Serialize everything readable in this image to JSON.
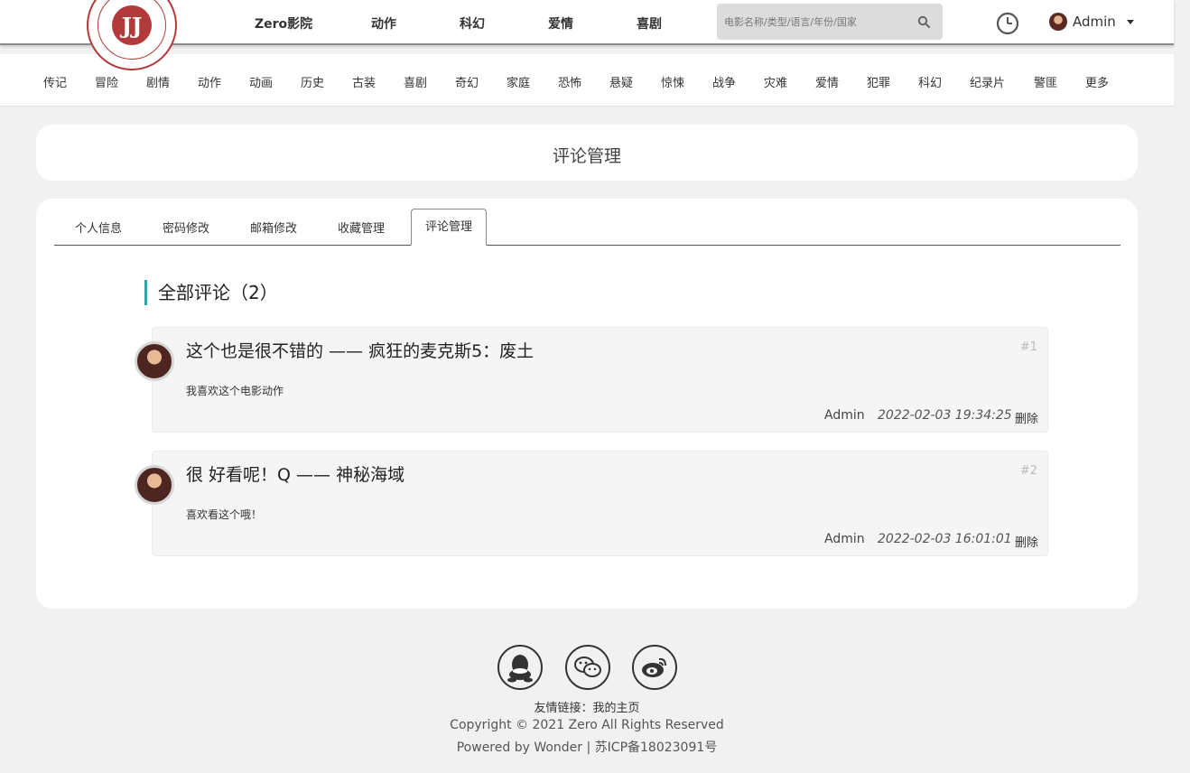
{
  "header": {
    "logo_text": "JJ",
    "nav": [
      "Zero影院",
      "动作",
      "科幻",
      "爱情",
      "喜剧"
    ],
    "search_placeholder": "电影名称/类型/语言/年份/国家",
    "user_name": "Admin"
  },
  "genres": [
    "传记",
    "冒险",
    "剧情",
    "动作",
    "动画",
    "历史",
    "古装",
    "喜剧",
    "奇幻",
    "家庭",
    "恐怖",
    "悬疑",
    "惊悚",
    "战争",
    "灾难",
    "爱情",
    "犯罪",
    "科幻",
    "纪录片",
    "警匪",
    "更多"
  ],
  "page_title": "评论管理",
  "tabs": [
    "个人信息",
    "密码修改",
    "邮箱修改",
    "收藏管理",
    "评论管理"
  ],
  "active_tab": "评论管理",
  "section_title": "全部评论（2）",
  "comments": [
    {
      "title": "这个也是很不错的 —— 疯狂的麦克斯5：废土",
      "num": "#1",
      "text": "我喜欢这个电影动作",
      "author": "Admin",
      "time": "2022-02-03 19:34:25",
      "delete_label": "删除"
    },
    {
      "title": "很 好看呢！Q —— 神秘海域",
      "num": "#2",
      "text": "喜欢看这个哦！",
      "author": "Admin",
      "time": "2022-02-03 16:01:01",
      "delete_label": "删除"
    }
  ],
  "footer": {
    "social_icons": [
      "qq-icon",
      "wechat-icon",
      "weibo-icon"
    ],
    "links": "友情链接：我的主页",
    "copyright": "Copyright © 2021 Zero All Rights Reserved",
    "powered": "Powered by Wonder | 苏ICP备18023091号"
  }
}
